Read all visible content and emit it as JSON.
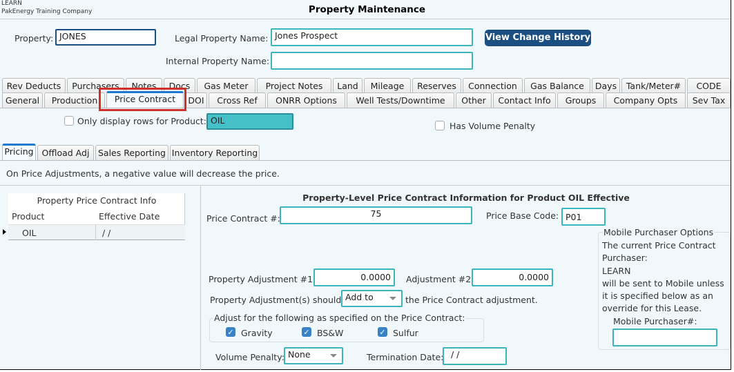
{
  "header": {
    "company_code": "LEARN",
    "company_name": "PakEnergy Training Company",
    "title": "Property Maintenance"
  },
  "form": {
    "property_label": "Property:",
    "property_value": "JONES",
    "legal_label": "Legal Property Name:",
    "legal_value": "Jones Prospect",
    "internal_label": "Internal Property Name:",
    "internal_value": "",
    "history_button": "View Change History"
  },
  "tabs_row1": [
    "Rev Deducts",
    "Purchasers",
    "Notes",
    "Docs",
    "Gas Meter",
    "Project Notes",
    "Land",
    "Mileage",
    "Reserves",
    "Connection",
    "Gas Balance",
    "Days",
    "Tank/Meter#",
    "CODE"
  ],
  "tabs_row2": [
    "General",
    "Production",
    "Price Contract",
    "DOI",
    "Cross Ref",
    "ONRR Options",
    "Well Tests/Downtime",
    "Other",
    "Contact Info",
    "Groups",
    "Company Opts",
    "Sev Tax"
  ],
  "selected_tab": "Price Contract",
  "filter": {
    "only_display_label": "Only display rows for Product:",
    "product": "OIL",
    "has_volume_penalty": "Has Volume Penalty"
  },
  "subtabs": [
    "Pricing",
    "Offload Adj",
    "Sales Reporting",
    "Inventory Reporting"
  ],
  "note": "On Price Adjustments, a negative value will decrease the price.",
  "grid": {
    "title": "Property Price Contract Info",
    "columns": [
      "Product",
      "Effective Date"
    ],
    "rows": [
      [
        "OIL",
        "/  /"
      ]
    ]
  },
  "detail": {
    "heading": "Property-Level Price Contract Information for Product OIL Effective",
    "price_contract_label": "Price Contract #:",
    "price_contract_value": "75",
    "base_code_label": "Price Base Code:",
    "base_code_value": "P01",
    "adj1_label": "Property Adjustment #1:",
    "adj1_value": "0.0000",
    "adj2_label": "Adjustment #2:",
    "adj2_value": "0.0000",
    "should_label": "Property Adjustment(s) should",
    "should_value": "Add to",
    "should_suffix": "the Price Contract adjustment.",
    "adjust_group": "Adjust for the following as specified on the Price Contract:",
    "gravity": "Gravity",
    "bsw": "BS&W",
    "sulfur": "Sulfur",
    "volume_penalty_label": "Volume Penalty:",
    "volume_penalty_value": "None",
    "termination_label": "Termination Date:",
    "termination_value": "/  /"
  },
  "mobile": {
    "title": "Mobile Purchaser Options",
    "line1": "The current Price Contract",
    "line2": "Purchaser:",
    "line3": "LEARN",
    "line4": "will be sent to Mobile unless",
    "line5": "it is specified below as an",
    "line6": "override for this Lease.",
    "field_label": "Mobile Purchaser#:",
    "field_value": ""
  },
  "colors": {
    "accent": "#3bb4bd",
    "button": "#1b4f82",
    "highlight": "#d0302a",
    "selected_tab": "#1e7ad0"
  }
}
